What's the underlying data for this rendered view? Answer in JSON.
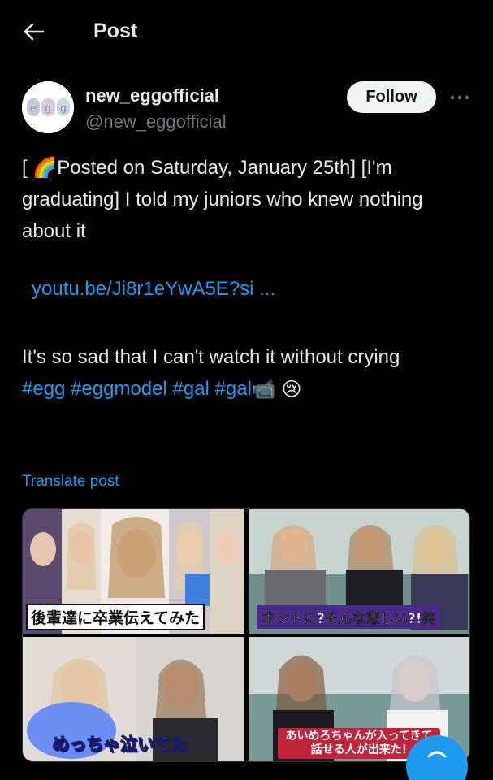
{
  "header": {
    "title": "Post"
  },
  "author": {
    "display_name": "new_eggofficial",
    "handle": "@new_eggofficial",
    "avatar_text": "egg",
    "follow_label": "Follow"
  },
  "post": {
    "line1": "[ 🌈Posted on Saturday, January 25th] [I'm graduating] I told my juniors who knew nothing about it",
    "link": "youtu.be/Ji8r1eYwA5E?si ...",
    "line2": "It's so sad that I can't watch it without crying",
    "hashtags": [
      "#egg",
      "#eggmodel",
      "#gal",
      "#gal"
    ],
    "emojis": [
      "📹",
      "😢"
    ],
    "translate_label": "Translate post"
  },
  "media": {
    "captions": [
      "後輩達に卒業伝えてみた",
      "ホントに?そんな悲しい?!笑",
      "めっちゃ泣いてた",
      "あいめろちゃんが入ってきて話せる人が出来た!"
    ]
  },
  "colors": {
    "accent": "#1d9bf0",
    "background": "#000000",
    "muted": "#71767b"
  }
}
